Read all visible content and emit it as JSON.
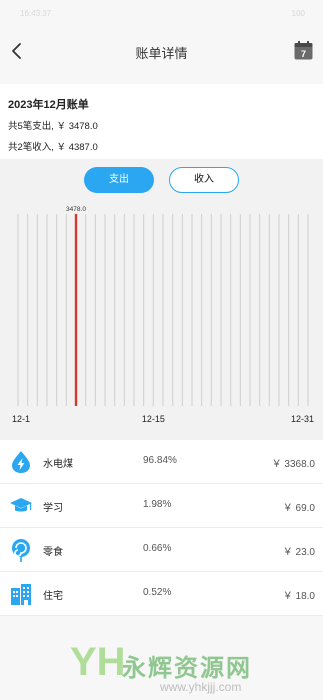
{
  "status_bar": {
    "time": "16:43:37",
    "battery": "100"
  },
  "header": {
    "title": "账单详情",
    "calendar_day": "7"
  },
  "summary": {
    "month_title": "2023年12月账单",
    "expense_line": "共5笔支出, ￥ 3478.0",
    "income_line": "共2笔收入, ￥ 4387.0"
  },
  "toggle": {
    "expense_label": "支出",
    "income_label": "收入",
    "selected": "expense"
  },
  "colors": {
    "accent": "#2aa7f0",
    "highlight_bar": "#d63a2e",
    "grid_line": "#cfcfcf"
  },
  "chart_data": {
    "type": "bar",
    "x": {
      "start_day": 1,
      "end_day": 31,
      "tick_labels": [
        "12-1",
        "12-15",
        "12-31"
      ]
    },
    "values": [
      0,
      0,
      0,
      0,
      0,
      0,
      0,
      0,
      0,
      0,
      0,
      0,
      0,
      0,
      0,
      0,
      0,
      0,
      0,
      0,
      0,
      0,
      0,
      0,
      0,
      0,
      0,
      0,
      0,
      0,
      0
    ],
    "highlight": {
      "day": 7,
      "value": 3478.0,
      "label": "3478.0"
    },
    "ylim": [
      0,
      3478.0
    ],
    "grid": true
  },
  "categories": [
    {
      "name": "水电煤",
      "percent": "96.84%",
      "amount": "￥ 3368.0",
      "icon": "lightning-icon"
    },
    {
      "name": "学习",
      "percent": "1.98%",
      "amount": "￥ 69.0",
      "icon": "graduation-cap-icon"
    },
    {
      "name": "零食",
      "percent": "0.66%",
      "amount": "￥ 23.0",
      "icon": "lollipop-icon"
    },
    {
      "name": "住宅",
      "percent": "0.52%",
      "amount": "￥ 18.0",
      "icon": "building-icon"
    }
  ],
  "watermark": {
    "logo": "YH",
    "text": "永辉资源网",
    "url": "www.yhkjjj.com"
  }
}
